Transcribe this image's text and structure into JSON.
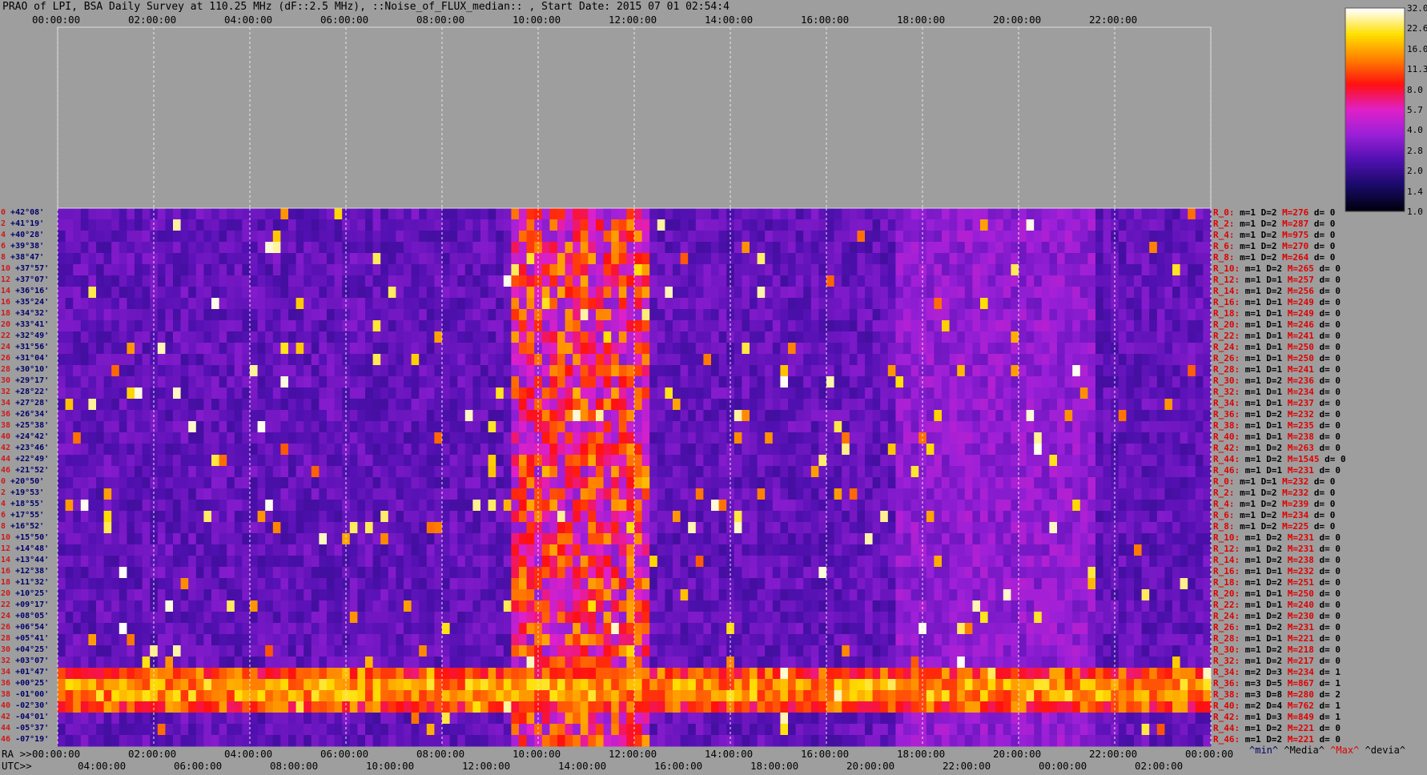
{
  "title": "PRAO of LPI, BSA Daily Survey at 110.25 MHz (dF::2.5 MHz), ::Noise_of_FLUX_median:: , Start Date: 2015 07 01 02:54:4",
  "top_axis_ticks": [
    "00:00:00",
    "02:00:00",
    "04:00:00",
    "06:00:00",
    "08:00:00",
    "10:00:00",
    "12:00:00",
    "14:00:00",
    "16:00:00",
    "18:00:00",
    "20:00:00",
    "22:00:00"
  ],
  "ra_axis": {
    "label": "RA >>",
    "ticks": [
      "00:00:00",
      "02:00:00",
      "04:00:00",
      "06:00:00",
      "08:00:00",
      "10:00:00",
      "12:00:00",
      "14:00:00",
      "16:00:00",
      "18:00:00",
      "20:00:00",
      "22:00:00",
      "00:00:00"
    ]
  },
  "utc_axis": {
    "label": "UTC>>",
    "ticks": [
      "04:00:00",
      "06:00:00",
      "08:00:00",
      "10:00:00",
      "12:00:00",
      "14:00:00",
      "16:00:00",
      "18:00:00",
      "20:00:00",
      "22:00:00",
      "00:00:00",
      "02:00:00"
    ]
  },
  "legend": {
    "min": "^min^",
    "media": "^Media^",
    "max": "^Max^",
    "devia": "^devia^"
  },
  "colorbar": {
    "ticks": [
      "32.0",
      "22.6",
      "16.0",
      "11.3",
      "8.0",
      "5.7",
      "4.0",
      "2.8",
      "2.0",
      "1.4",
      "1.0"
    ]
  },
  "colors": {
    "background": "#9e9e9e",
    "decl_text": "#00006a",
    "index_text": "#d01818",
    "beam_text": "#e00000",
    "max_text": "#e00000"
  },
  "left_labels": [
    {
      "idx": "0",
      "decl": "+42°08'"
    },
    {
      "idx": "2",
      "decl": "+41°19'"
    },
    {
      "idx": "4",
      "decl": "+40°28'"
    },
    {
      "idx": "6",
      "decl": "+39°38'"
    },
    {
      "idx": "8",
      "decl": "+38°47'"
    },
    {
      "idx": "10",
      "decl": "+37°57'"
    },
    {
      "idx": "12",
      "decl": "+37°07'"
    },
    {
      "idx": "14",
      "decl": "+36°16'"
    },
    {
      "idx": "16",
      "decl": "+35°24'"
    },
    {
      "idx": "18",
      "decl": "+34°32'"
    },
    {
      "idx": "20",
      "decl": "+33°41'"
    },
    {
      "idx": "22",
      "decl": "+32°49'"
    },
    {
      "idx": "24",
      "decl": "+31°56'"
    },
    {
      "idx": "26",
      "decl": "+31°04'"
    },
    {
      "idx": "28",
      "decl": "+30°10'"
    },
    {
      "idx": "30",
      "decl": "+29°17'"
    },
    {
      "idx": "32",
      "decl": "+28°22'"
    },
    {
      "idx": "34",
      "decl": "+27°28'"
    },
    {
      "idx": "36",
      "decl": "+26°34'"
    },
    {
      "idx": "38",
      "decl": "+25°38'"
    },
    {
      "idx": "40",
      "decl": "+24°42'"
    },
    {
      "idx": "42",
      "decl": "+23°46'"
    },
    {
      "idx": "44",
      "decl": "+22°49'"
    },
    {
      "idx": "46",
      "decl": "+21°52'"
    },
    {
      "idx": "0",
      "decl": "+20°50'"
    },
    {
      "idx": "2",
      "decl": "+19°53'"
    },
    {
      "idx": "4",
      "decl": "+18°55'"
    },
    {
      "idx": "6",
      "decl": "+17°55'"
    },
    {
      "idx": "8",
      "decl": "+16°52'"
    },
    {
      "idx": "10",
      "decl": "+15°50'"
    },
    {
      "idx": "12",
      "decl": "+14°48'"
    },
    {
      "idx": "14",
      "decl": "+13°44'"
    },
    {
      "idx": "16",
      "decl": "+12°38'"
    },
    {
      "idx": "18",
      "decl": "+11°32'"
    },
    {
      "idx": "20",
      "decl": "+10°25'"
    },
    {
      "idx": "22",
      "decl": "+09°17'"
    },
    {
      "idx": "24",
      "decl": "+08°05'"
    },
    {
      "idx": "26",
      "decl": "+06°54'"
    },
    {
      "idx": "28",
      "decl": "+05°41'"
    },
    {
      "idx": "30",
      "decl": "+04°25'"
    },
    {
      "idx": "32",
      "decl": "+03°07'"
    },
    {
      "idx": "34",
      "decl": "+01°47'"
    },
    {
      "idx": "36",
      "decl": "+00°25'"
    },
    {
      "idx": "38",
      "decl": "-01°00'"
    },
    {
      "idx": "40",
      "decl": "-02°30'"
    },
    {
      "idx": "42",
      "decl": "-04°01'"
    },
    {
      "idx": "44",
      "decl": "-05°37'"
    },
    {
      "idx": "46",
      "decl": "-07°19'"
    }
  ],
  "right_rows": [
    {
      "name": "R_0:",
      "m": "m=1",
      "D": "D=2",
      "M": "M=276",
      "d": "d= 0"
    },
    {
      "name": "R_2:",
      "m": "m=1",
      "D": "D=2",
      "M": "M=287",
      "d": "d= 0"
    },
    {
      "name": "R_4:",
      "m": "m=1",
      "D": "D=2",
      "M": "M=975",
      "d": "d= 0"
    },
    {
      "name": "R_6:",
      "m": "m=1",
      "D": "D=2",
      "M": "M=270",
      "d": "d= 0"
    },
    {
      "name": "R_8:",
      "m": "m=1",
      "D": "D=2",
      "M": "M=264",
      "d": "d= 0"
    },
    {
      "name": "R_10:",
      "m": "m=1",
      "D": "D=2",
      "M": "M=265",
      "d": "d= 0"
    },
    {
      "name": "R_12:",
      "m": "m=1",
      "D": "D=1",
      "M": "M=257",
      "d": "d= 0"
    },
    {
      "name": "R_14:",
      "m": "m=1",
      "D": "D=2",
      "M": "M=256",
      "d": "d= 0"
    },
    {
      "name": "R_16:",
      "m": "m=1",
      "D": "D=1",
      "M": "M=249",
      "d": "d= 0"
    },
    {
      "name": "R_18:",
      "m": "m=1",
      "D": "D=1",
      "M": "M=249",
      "d": "d= 0"
    },
    {
      "name": "R_20:",
      "m": "m=1",
      "D": "D=1",
      "M": "M=246",
      "d": "d= 0"
    },
    {
      "name": "R_22:",
      "m": "m=1",
      "D": "D=1",
      "M": "M=241",
      "d": "d= 0"
    },
    {
      "name": "R_24:",
      "m": "m=1",
      "D": "D=1",
      "M": "M=250",
      "d": "d= 0"
    },
    {
      "name": "R_26:",
      "m": "m=1",
      "D": "D=1",
      "M": "M=250",
      "d": "d= 0"
    },
    {
      "name": "R_28:",
      "m": "m=1",
      "D": "D=1",
      "M": "M=241",
      "d": "d= 0"
    },
    {
      "name": "R_30:",
      "m": "m=1",
      "D": "D=2",
      "M": "M=236",
      "d": "d= 0"
    },
    {
      "name": "R_32:",
      "m": "m=1",
      "D": "D=1",
      "M": "M=234",
      "d": "d= 0"
    },
    {
      "name": "R_34:",
      "m": "m=1",
      "D": "D=1",
      "M": "M=237",
      "d": "d= 0"
    },
    {
      "name": "R_36:",
      "m": "m=1",
      "D": "D=2",
      "M": "M=232",
      "d": "d= 0"
    },
    {
      "name": "R_38:",
      "m": "m=1",
      "D": "D=1",
      "M": "M=235",
      "d": "d= 0"
    },
    {
      "name": "R_40:",
      "m": "m=1",
      "D": "D=1",
      "M": "M=238",
      "d": "d= 0"
    },
    {
      "name": "R_42:",
      "m": "m=1",
      "D": "D=2",
      "M": "M=263",
      "d": "d= 0"
    },
    {
      "name": "R_44:",
      "m": "m=1",
      "D": "D=2",
      "M": "M=1545",
      "d": "d= 0"
    },
    {
      "name": "R_46:",
      "m": "m=1",
      "D": "D=1",
      "M": "M=231",
      "d": "d= 0"
    },
    {
      "name": "R_0:",
      "m": "m=1",
      "D": "D=1",
      "M": "M=232",
      "d": "d= 0"
    },
    {
      "name": "R_2:",
      "m": "m=1",
      "D": "D=2",
      "M": "M=232",
      "d": "d= 0"
    },
    {
      "name": "R_4:",
      "m": "m=1",
      "D": "D=2",
      "M": "M=239",
      "d": "d= 0"
    },
    {
      "name": "R_6:",
      "m": "m=1",
      "D": "D=2",
      "M": "M=234",
      "d": "d= 0"
    },
    {
      "name": "R_8:",
      "m": "m=1",
      "D": "D=2",
      "M": "M=225",
      "d": "d= 0"
    },
    {
      "name": "R_10:",
      "m": "m=1",
      "D": "D=2",
      "M": "M=231",
      "d": "d= 0"
    },
    {
      "name": "R_12:",
      "m": "m=1",
      "D": "D=2",
      "M": "M=231",
      "d": "d= 0"
    },
    {
      "name": "R_14:",
      "m": "m=1",
      "D": "D=2",
      "M": "M=238",
      "d": "d= 0"
    },
    {
      "name": "R_16:",
      "m": "m=1",
      "D": "D=1",
      "M": "M=232",
      "d": "d= 0"
    },
    {
      "name": "R_18:",
      "m": "m=1",
      "D": "D=2",
      "M": "M=251",
      "d": "d= 0"
    },
    {
      "name": "R_20:",
      "m": "m=1",
      "D": "D=1",
      "M": "M=250",
      "d": "d= 0"
    },
    {
      "name": "R_22:",
      "m": "m=1",
      "D": "D=1",
      "M": "M=240",
      "d": "d= 0"
    },
    {
      "name": "R_24:",
      "m": "m=1",
      "D": "D=2",
      "M": "M=230",
      "d": "d= 0"
    },
    {
      "name": "R_26:",
      "m": "m=1",
      "D": "D=2",
      "M": "M=231",
      "d": "d= 0"
    },
    {
      "name": "R_28:",
      "m": "m=1",
      "D": "D=1",
      "M": "M=221",
      "d": "d= 0"
    },
    {
      "name": "R_30:",
      "m": "m=1",
      "D": "D=2",
      "M": "M=218",
      "d": "d= 0"
    },
    {
      "name": "R_32:",
      "m": "m=1",
      "D": "D=2",
      "M": "M=217",
      "d": "d= 0"
    },
    {
      "name": "R_34:",
      "m": "m=2",
      "D": "D=3",
      "M": "M=234",
      "d": "d= 1"
    },
    {
      "name": "R_36:",
      "m": "m=3",
      "D": "D=5",
      "M": "M=867",
      "d": "d= 1"
    },
    {
      "name": "R_38:",
      "m": "m=3",
      "D": "D=8",
      "M": "M=280",
      "d": "d= 2"
    },
    {
      "name": "R_40:",
      "m": "m=2",
      "D": "D=4",
      "M": "M=762",
      "d": "d= 1"
    },
    {
      "name": "R_42:",
      "m": "m=1",
      "D": "D=3",
      "M": "M=849",
      "d": "d= 1"
    },
    {
      "name": "R_44:",
      "m": "m=1",
      "D": "D=2",
      "M": "M=221",
      "d": "d= 0"
    },
    {
      "name": "R_46:",
      "m": "m=1",
      "D": "D=2",
      "M": "M=221",
      "d": "d= 0"
    }
  ],
  "chart_data": {
    "type": "heatmap",
    "title": "PRAO of LPI, BSA Daily Survey at 110.25 MHz (dF::2.5 MHz), ::Noise_of_FLUX_median:: , Start Date: 2015 07 01 02:54:4",
    "xlabel": "",
    "ylabel": "",
    "x_range_hours_ra": [
      0,
      24
    ],
    "declinations": [
      "+42°08'",
      "+41°19'",
      "+40°28'",
      "+39°38'",
      "+38°47'",
      "+37°57'",
      "+37°07'",
      "+36°16'",
      "+35°24'",
      "+34°32'",
      "+33°41'",
      "+32°49'",
      "+31°56'",
      "+31°04'",
      "+30°10'",
      "+29°17'",
      "+28°22'",
      "+27°28'",
      "+26°34'",
      "+25°38'",
      "+24°42'",
      "+23°46'",
      "+22°49'",
      "+21°52'",
      "+20°50'",
      "+19°53'",
      "+18°55'",
      "+17°55'",
      "+16°52'",
      "+15°50'",
      "+14°48'",
      "+13°44'",
      "+12°38'",
      "+11°32'",
      "+10°25'",
      "+09°17'",
      "+08°05'",
      "+06°54'",
      "+05°41'",
      "+04°25'",
      "+03°07'",
      "+01°47'",
      "+00°25'",
      "-01°00'",
      "-02°30'",
      "-04°01'",
      "-05°37'",
      "-07°19'"
    ],
    "colorbar_range": [
      1.0,
      32.0
    ],
    "colorbar_scale": "log2",
    "colormap": [
      "#000010",
      "#1a0a6a",
      "#5010b0",
      "#9a20d8",
      "#e020c8",
      "#ff1010",
      "#ff8000",
      "#ffe000",
      "#ffffff"
    ],
    "row_medians": [
      1,
      1,
      1,
      1,
      1,
      1,
      1,
      1,
      1,
      1,
      1,
      1,
      1,
      1,
      1,
      1,
      1,
      1,
      1,
      1,
      1,
      1,
      1,
      1,
      1,
      1,
      1,
      1,
      1,
      1,
      1,
      1,
      1,
      1,
      1,
      1,
      1,
      1,
      1,
      1,
      1,
      2,
      3,
      3,
      2,
      1,
      1,
      1
    ],
    "row_max": [
      276,
      287,
      975,
      270,
      264,
      265,
      257,
      256,
      249,
      249,
      246,
      241,
      250,
      250,
      241,
      236,
      234,
      237,
      232,
      235,
      238,
      263,
      1545,
      231,
      232,
      232,
      239,
      234,
      225,
      231,
      231,
      238,
      232,
      251,
      250,
      240,
      230,
      231,
      221,
      218,
      217,
      234,
      867,
      280,
      762,
      849,
      221,
      221
    ]
  }
}
